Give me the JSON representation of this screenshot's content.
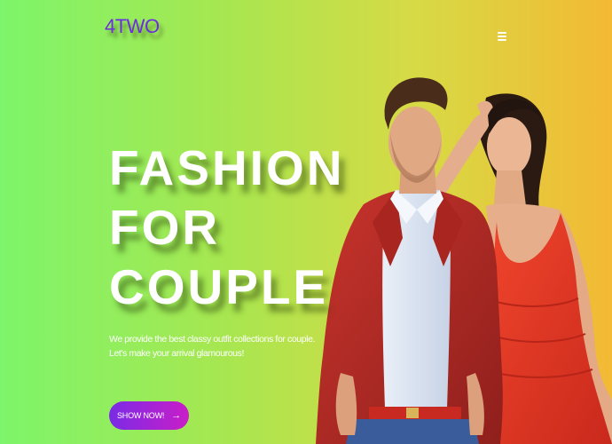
{
  "header": {
    "logo": "4TWO",
    "menu_icon": "hamburger-menu-icon"
  },
  "hero": {
    "headline_lines": [
      "FASHION",
      "FOR",
      "COUPLE"
    ],
    "subtext_lines": [
      "We provide the best classy outfit collections for couple.",
      "Let's make your arrival glamourous!"
    ],
    "cta_label": "SHOW NOW!",
    "cta_icon": "arrow-right-icon",
    "image": "couple-fashion-photo"
  },
  "colors": {
    "gradient_start": "#7df56a",
    "gradient_end": "#f3b934",
    "logo": "#6d2ce0",
    "cta_start": "#7a2be6",
    "cta_end": "#c91ec8",
    "text": "#ffffff"
  }
}
